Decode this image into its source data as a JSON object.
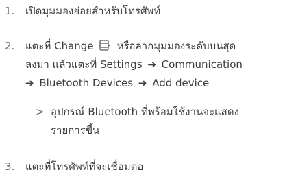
{
  "steps": [
    {
      "number": "1.",
      "text": "เปิดมุมมองย่อยสำหรับโทรศัพท์"
    },
    {
      "number": "2.",
      "line1_before_icon": "แตะที่ Change",
      "line1_after_icon": "หรือลากมุมมองระดับบนสุด",
      "line2_a": "ลงมา แล้วแตะที่ Settings",
      "line2_b": "Communication",
      "line3_a": "Bluetooth Devices",
      "line3_b": "Add device",
      "icon": "change-icon",
      "arrow_glyph": "➔",
      "sub": {
        "marker": ">",
        "line1": "อุปกรณ์ Bluetooth ที่พร้อมใช้งานจะแสดง",
        "line2": "รายการขึ้น"
      }
    },
    {
      "number": "3.",
      "text": "แตะที่โทรศัพท์ที่จะเชื่อมต่อ"
    }
  ]
}
